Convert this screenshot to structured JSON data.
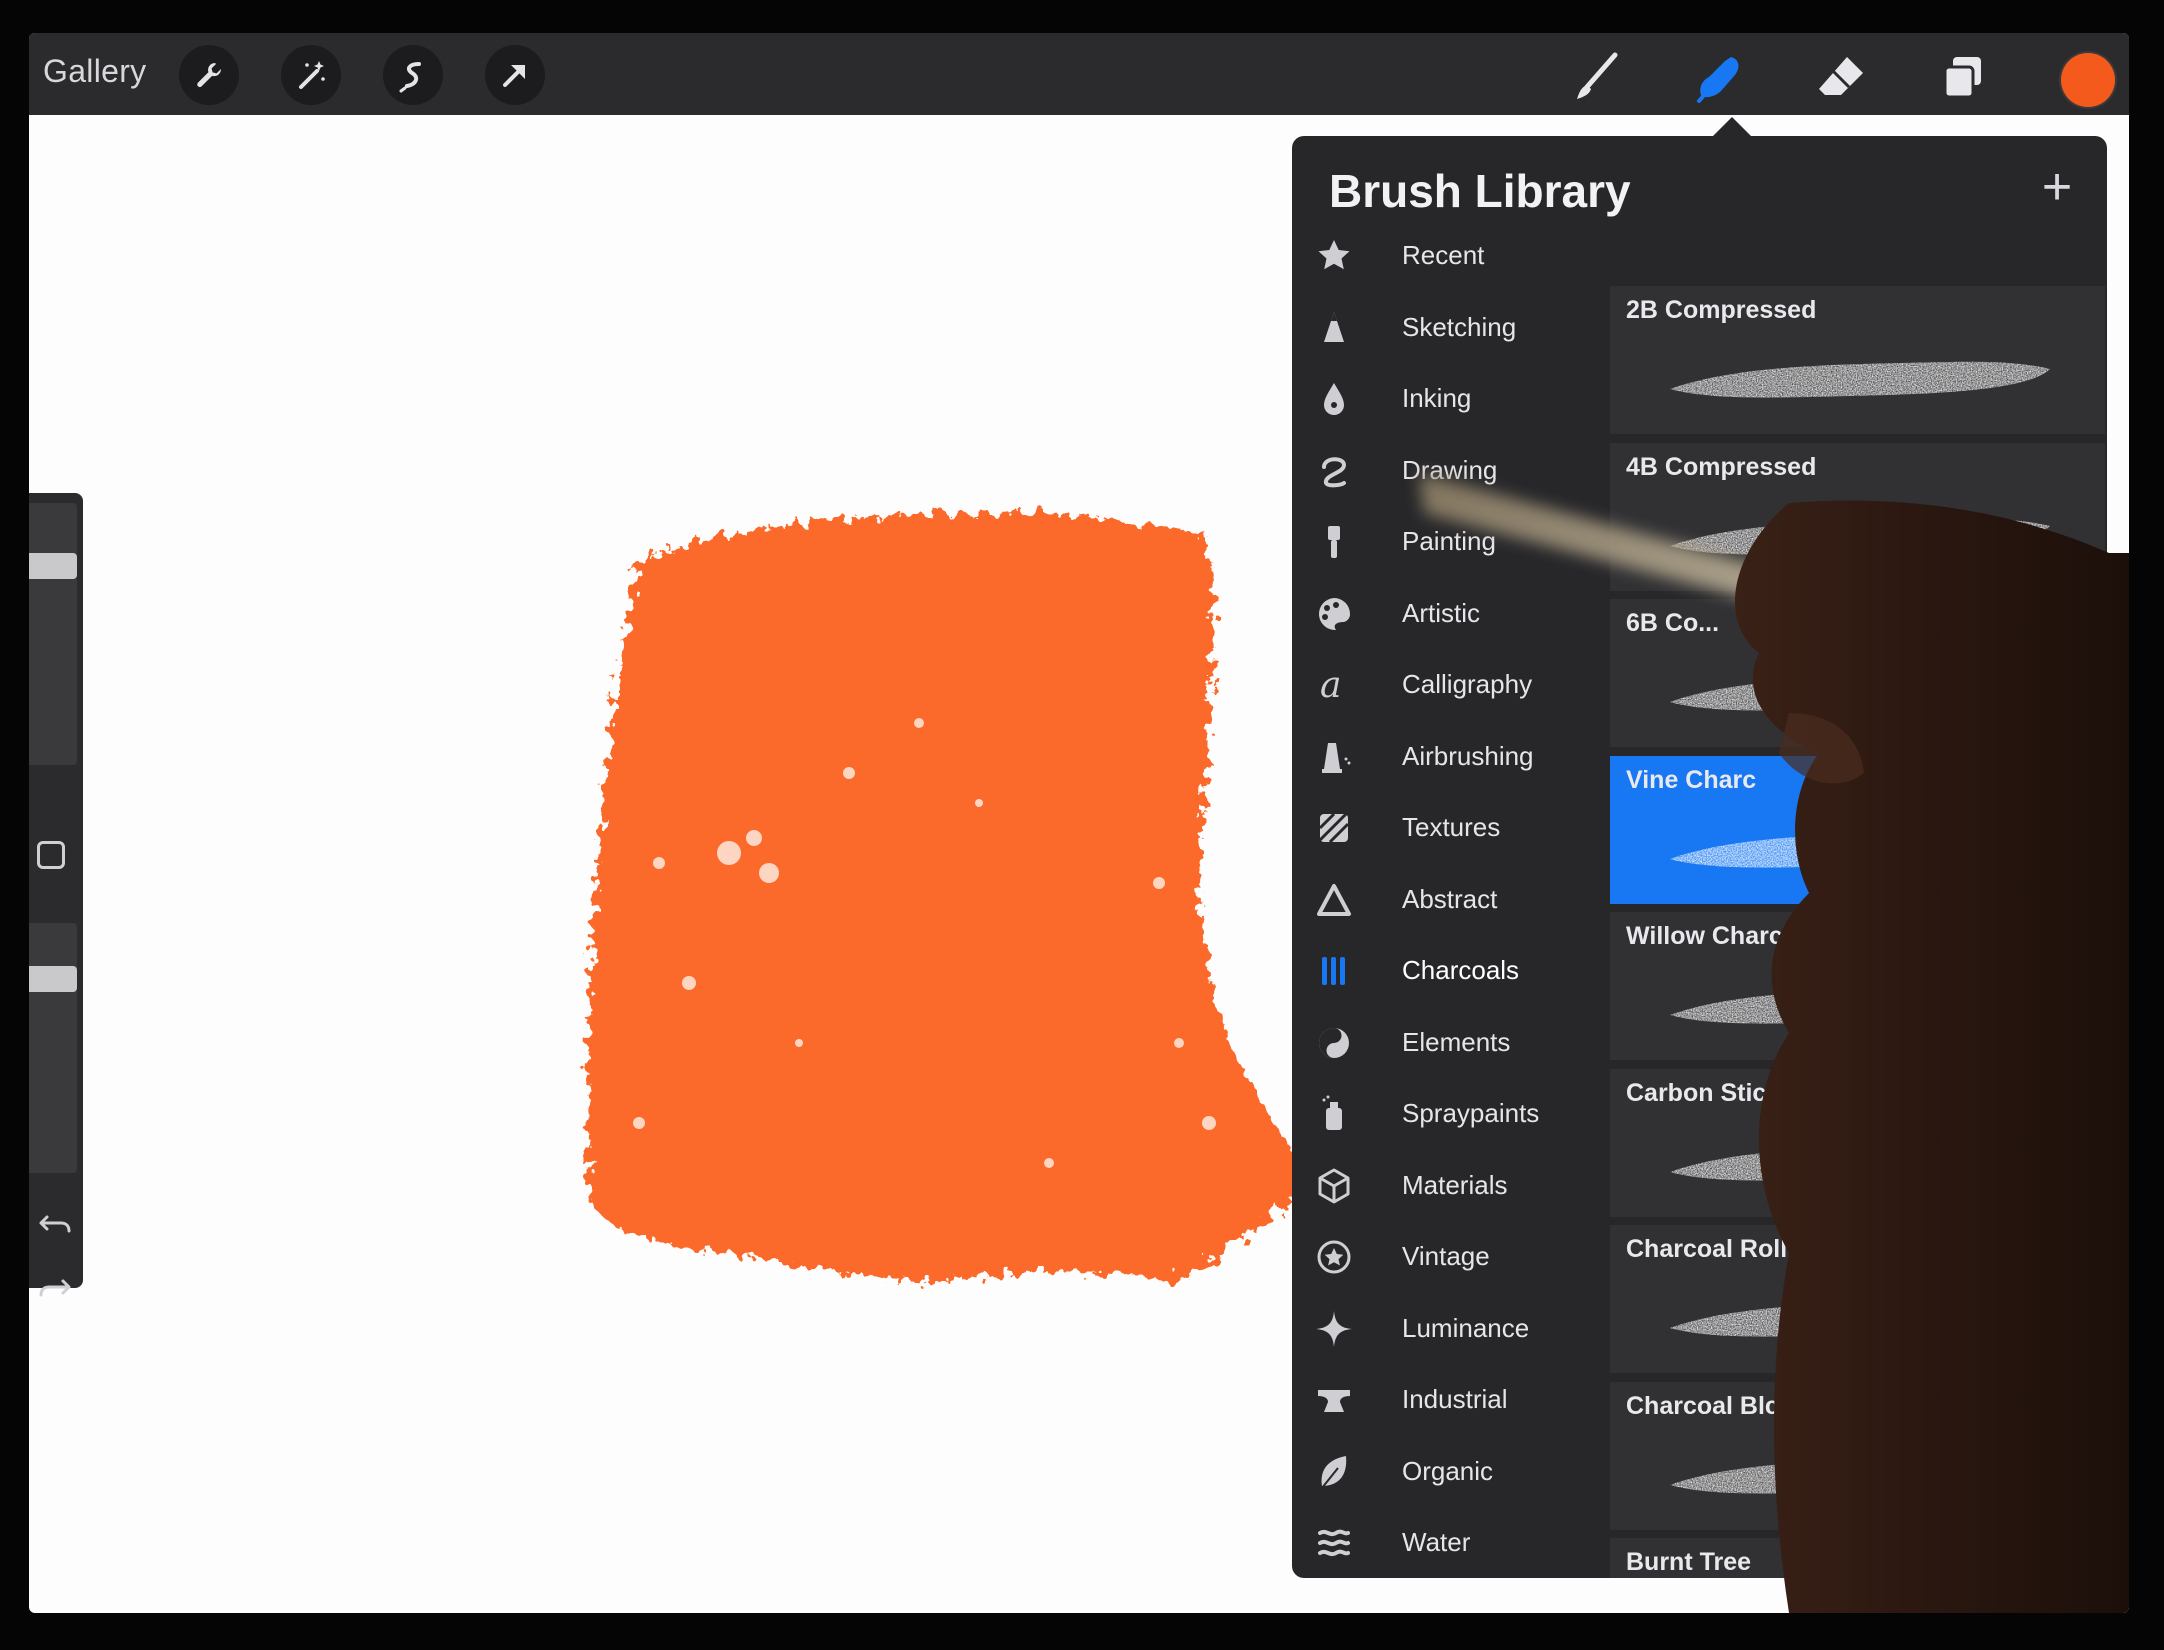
{
  "topbar": {
    "gallery_label": "Gallery",
    "left_tools": [
      "wrench-icon",
      "magic-wand-icon",
      "selection-icon",
      "transform-arrow-icon"
    ],
    "right_tools": [
      "brush-icon",
      "smudge-icon",
      "eraser-icon",
      "layers-icon"
    ],
    "active_tool": "smudge-icon",
    "current_color": "#f45a1c",
    "active_tool_color": "#1877f2"
  },
  "canvas": {
    "paint_color": "#fb6a2c"
  },
  "sidebar": {
    "brush_size_level": 0.95,
    "opacity_level": 0.6,
    "icons": [
      "modify-square-icon",
      "undo-icon",
      "redo-icon"
    ]
  },
  "library": {
    "title": "Brush Library",
    "add_icon": "plus-icon",
    "categories": [
      {
        "label": "Recent",
        "icon": "star-icon"
      },
      {
        "label": "Sketching",
        "icon": "pencil-tip-icon"
      },
      {
        "label": "Inking",
        "icon": "ink-drop-icon"
      },
      {
        "label": "Drawing",
        "icon": "squiggle-icon"
      },
      {
        "label": "Painting",
        "icon": "paintbrush-icon"
      },
      {
        "label": "Artistic",
        "icon": "palette-icon"
      },
      {
        "label": "Calligraphy",
        "icon": "script-a-icon"
      },
      {
        "label": "Airbrushing",
        "icon": "airbrush-icon"
      },
      {
        "label": "Textures",
        "icon": "texture-icon"
      },
      {
        "label": "Abstract",
        "icon": "triangle-icon"
      },
      {
        "label": "Charcoals",
        "icon": "charcoal-sticks-icon"
      },
      {
        "label": "Elements",
        "icon": "yin-yang-icon"
      },
      {
        "label": "Spraypaints",
        "icon": "spray-can-icon"
      },
      {
        "label": "Materials",
        "icon": "cube-icon"
      },
      {
        "label": "Vintage",
        "icon": "star-badge-icon"
      },
      {
        "label": "Luminance",
        "icon": "sparkle-icon"
      },
      {
        "label": "Industrial",
        "icon": "anvil-icon"
      },
      {
        "label": "Organic",
        "icon": "leaf-icon"
      },
      {
        "label": "Water",
        "icon": "waves-icon"
      }
    ],
    "selected_category": "Charcoals",
    "brushes": [
      {
        "label": "2B Compressed"
      },
      {
        "label": "4B Compressed"
      },
      {
        "label": "6B Co..."
      },
      {
        "label": "Vine Charc"
      },
      {
        "label": "Willow Charcoal"
      },
      {
        "label": "Carbon Stick"
      },
      {
        "label": "Charcoal Roll"
      },
      {
        "label": "Charcoal Blc"
      },
      {
        "label": "Burnt Tree"
      }
    ],
    "selected_brush_index": 3
  }
}
